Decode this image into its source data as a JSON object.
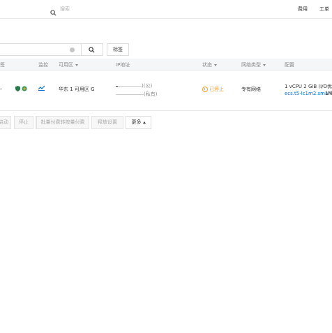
{
  "topbar": {
    "search_placeholder": "搜索",
    "links": [
      "费用",
      "工单"
    ]
  },
  "toolbar": {
    "tag_label": "标签"
  },
  "table": {
    "columns": {
      "col0": "签",
      "monitor": "监控",
      "zone": "可用区",
      "ip": "IP地址",
      "status": "状态",
      "network_type": "网络类型",
      "config": "配置"
    },
    "row": {
      "zone": "华东 1 可用区 G",
      "public_ip_suffix": ")(公)",
      "private_ip_suffix": "(私有)",
      "status": "已停止",
      "network_type": "专有网络",
      "config_line1": "1 vCPU 2 GiB (I/O优化)",
      "config_line2": "ecs.t5-lc1m2.small",
      "config_line3": "1M"
    }
  },
  "actions": [
    "启动",
    "停止",
    "重启",
    "批量付费转按量付费",
    "释放设置",
    "更多"
  ],
  "colors": {
    "status_stopped": "#f59a23",
    "link": "#0070cc",
    "header_bg": "#f4f6f8"
  }
}
